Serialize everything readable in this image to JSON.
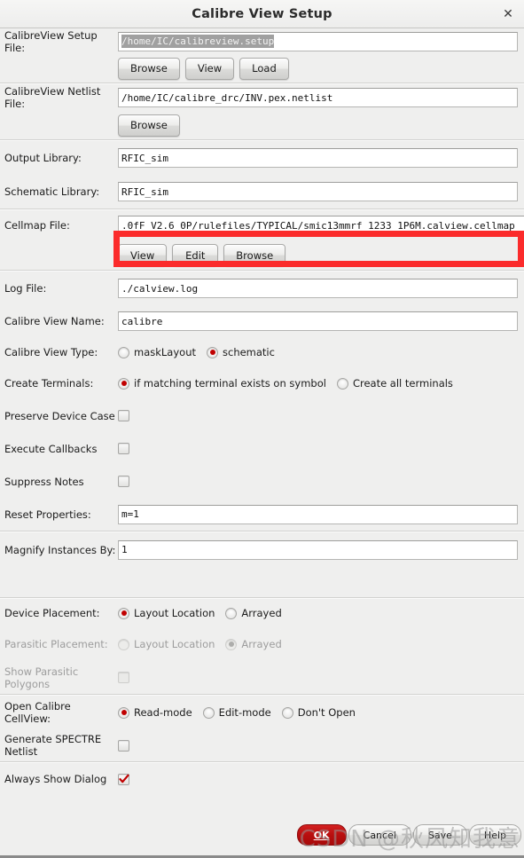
{
  "window": {
    "title": "Calibre View Setup",
    "close_icon": "close-icon"
  },
  "fields": {
    "setup_file": {
      "label": "CalibreView Setup File:",
      "value": "/home/IC/calibreview.setup",
      "selected": true,
      "buttons": [
        "Browse",
        "View",
        "Load"
      ]
    },
    "netlist_file": {
      "label": "CalibreView Netlist File:",
      "value": "/home/IC/calibre_drc/INV.pex.netlist",
      "buttons": [
        "Browse"
      ]
    },
    "output_library": {
      "label": "Output Library:",
      "value": "RFIC_sim"
    },
    "schematic_library": {
      "label": "Schematic Library:",
      "value": "RFIC_sim"
    },
    "cellmap_file": {
      "label": "Cellmap File:",
      "value": ".0fF_V2.6_0P/rulefiles/TYPICAL/smic13mmrf_1233_1P6M.calview.cellmap",
      "buttons": [
        "View",
        "Edit",
        "Browse"
      ],
      "highlight_color": "#fb2b2b"
    },
    "log_file": {
      "label": "Log File:",
      "value": "./calview.log"
    },
    "view_name": {
      "label": "Calibre View Name:",
      "value": "calibre"
    },
    "view_type": {
      "label": "Calibre View Type:",
      "options": [
        {
          "label": "maskLayout",
          "checked": false
        },
        {
          "label": "schematic",
          "checked": true
        }
      ]
    },
    "create_terminals": {
      "label": "Create Terminals:",
      "options": [
        {
          "label": "if matching terminal exists on symbol",
          "checked": true
        },
        {
          "label": "Create all terminals",
          "checked": false
        }
      ]
    },
    "preserve_device_case": {
      "label": "Preserve Device Case",
      "checked": false
    },
    "execute_callbacks": {
      "label": "Execute Callbacks",
      "checked": false
    },
    "suppress_notes": {
      "label": "Suppress Notes",
      "checked": false
    },
    "reset_properties": {
      "label": "Reset Properties:",
      "value": "m=1"
    },
    "magnify_instances": {
      "label": "Magnify Instances By:",
      "value": "1"
    },
    "device_placement": {
      "label": "Device Placement:",
      "options": [
        {
          "label": "Layout Location",
          "checked": true
        },
        {
          "label": "Arrayed",
          "checked": false
        }
      ]
    },
    "parasitic_placement": {
      "label": "Parasitic Placement:",
      "disabled": true,
      "options": [
        {
          "label": "Layout Location",
          "checked": false
        },
        {
          "label": "Arrayed",
          "checked": true
        }
      ]
    },
    "show_parasitic_polygons": {
      "label": "Show Parasitic Polygons",
      "checked": false,
      "disabled": true
    },
    "open_cellview": {
      "label": "Open Calibre CellView:",
      "options": [
        {
          "label": "Read-mode",
          "checked": true
        },
        {
          "label": "Edit-mode",
          "checked": false
        },
        {
          "label": "Don't Open",
          "checked": false
        }
      ]
    },
    "generate_spectre": {
      "label": "Generate SPECTRE Netlist",
      "checked": false
    },
    "always_show_dialog": {
      "label": "Always Show Dialog",
      "checked": true
    }
  },
  "footer": {
    "ok": "OK",
    "cancel": "Cancel",
    "save": "Save",
    "help": "Help"
  },
  "watermark": "CSDN @秋风知我意"
}
